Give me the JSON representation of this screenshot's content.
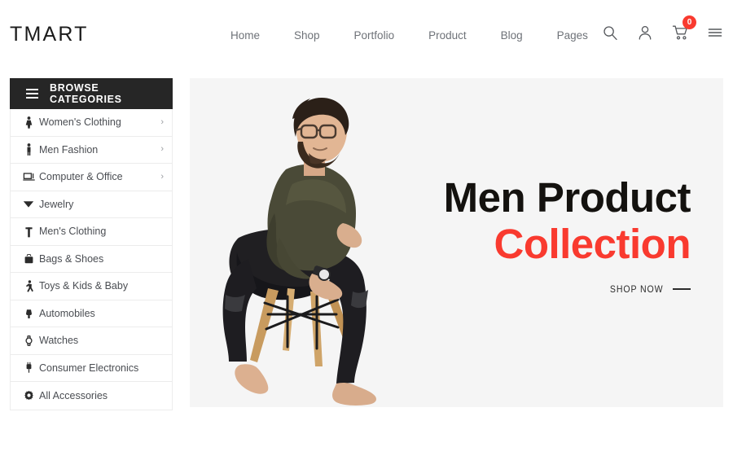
{
  "header": {
    "logo": "TMART",
    "nav": [
      {
        "label": "Home"
      },
      {
        "label": "Shop"
      },
      {
        "label": "Portfolio"
      },
      {
        "label": "Product"
      },
      {
        "label": "Blog"
      },
      {
        "label": "Pages"
      }
    ],
    "icons": {
      "search": "search-icon",
      "account": "user-icon",
      "cart": "cart-icon",
      "menu": "hamburger-icon"
    },
    "cart_count": "0",
    "cart_badge_color": "#f93a2f"
  },
  "sidebar": {
    "title": "BROWSE CATEGORIES",
    "header_bg": "#262626",
    "items": [
      {
        "label": "Women's Clothing",
        "icon": "woman-icon",
        "has_arrow": true,
        "arrow": "›"
      },
      {
        "label": "Men Fashion",
        "icon": "man-icon",
        "has_arrow": true,
        "arrow": "›"
      },
      {
        "label": "Computer & Office",
        "icon": "laptop-icon",
        "has_arrow": true,
        "arrow": "›"
      },
      {
        "label": "Jewelry",
        "icon": "gem-icon",
        "has_arrow": false,
        "arrow": ""
      },
      {
        "label": "Men's Clothing",
        "icon": "shirt-icon",
        "has_arrow": false,
        "arrow": ""
      },
      {
        "label": "Bags & Shoes",
        "icon": "bag-icon",
        "has_arrow": false,
        "arrow": ""
      },
      {
        "label": "Toys & Kids & Baby",
        "icon": "child-icon",
        "has_arrow": false,
        "arrow": ""
      },
      {
        "label": "Automobiles",
        "icon": "car-icon",
        "has_arrow": false,
        "arrow": ""
      },
      {
        "label": "Watches",
        "icon": "watch-icon",
        "has_arrow": false,
        "arrow": ""
      },
      {
        "label": "Consumer Electronics",
        "icon": "plug-icon",
        "has_arrow": false,
        "arrow": ""
      },
      {
        "label": "All Accessories",
        "icon": "gear-icon",
        "has_arrow": false,
        "arrow": ""
      }
    ]
  },
  "hero": {
    "background": "#f5f5f5",
    "title_line1": "Men Product",
    "title_line2": "Collection",
    "title_line1_color": "#14120f",
    "title_line2_color": "#f93a2f",
    "cta_label": "SHOP NOW",
    "image_alt": "seated-man-model"
  }
}
